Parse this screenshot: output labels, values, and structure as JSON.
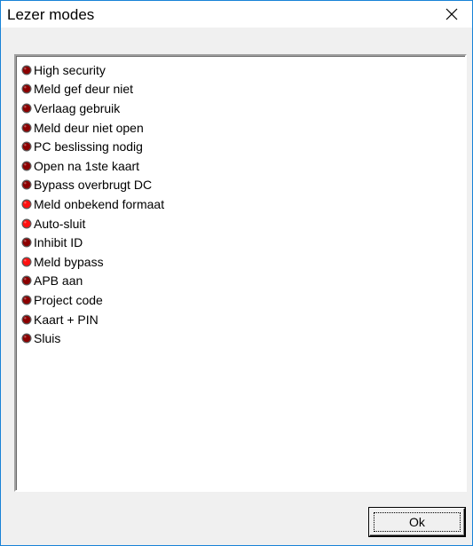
{
  "window": {
    "title": "Lezer modes",
    "accent_color": "#1883d7"
  },
  "titlebar": {
    "close_icon": "close-icon"
  },
  "modes": [
    {
      "label": "High security",
      "state": "off"
    },
    {
      "label": "Meld gef deur niet",
      "state": "off"
    },
    {
      "label": "Verlaag gebruik",
      "state": "off"
    },
    {
      "label": "Meld deur niet open",
      "state": "off"
    },
    {
      "label": "PC beslissing nodig",
      "state": "off"
    },
    {
      "label": "Open na 1ste kaart",
      "state": "off"
    },
    {
      "label": "Bypass overbrugt DC",
      "state": "off"
    },
    {
      "label": "Meld onbekend formaat",
      "state": "on"
    },
    {
      "label": "Auto-sluit",
      "state": "on"
    },
    {
      "label": "Inhibit ID",
      "state": "off"
    },
    {
      "label": "Meld bypass",
      "state": "on"
    },
    {
      "label": "APB aan",
      "state": "off"
    },
    {
      "label": "Project code",
      "state": "off"
    },
    {
      "label": "Kaart + PIN",
      "state": "off"
    },
    {
      "label": "Sluis",
      "state": "off"
    }
  ],
  "led_colors": {
    "on": "#ff1010",
    "off": "#8b0000"
  },
  "buttons": {
    "ok_label": "Ok"
  }
}
